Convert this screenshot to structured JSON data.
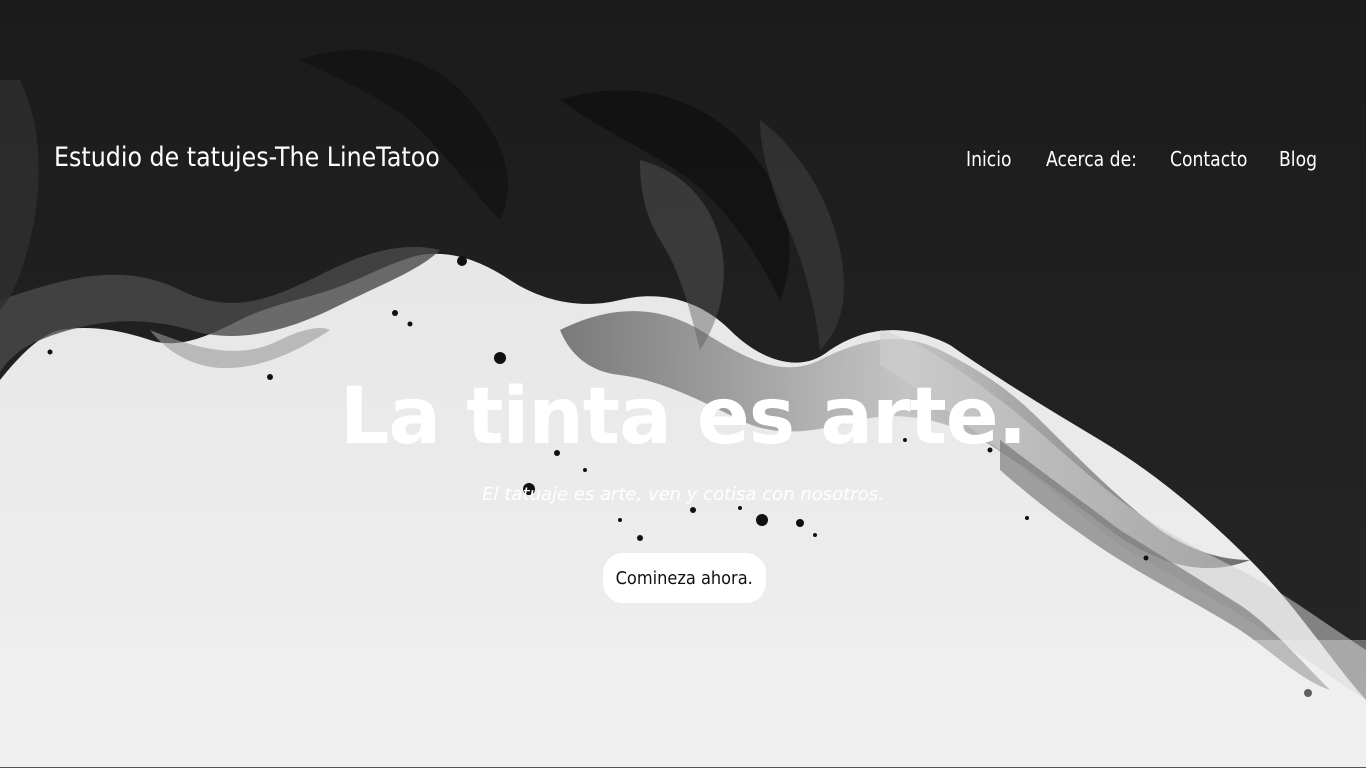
{
  "header": {
    "site_title": "Estudio de tatujes-The LineTatoo",
    "nav": [
      {
        "label": "Inicio"
      },
      {
        "label": "Acerca de:"
      },
      {
        "label": "Contacto"
      },
      {
        "label": "Blog"
      }
    ]
  },
  "hero": {
    "headline": "La tinta es arte.",
    "subheadline": "El tatuaje es arte, ven y cotisa con nosotros.",
    "cta_label": "Comineza ahora.",
    "background": "black-and-white-ink-splash"
  },
  "colors": {
    "dark_ink": "#1a1a1a",
    "light_background": "#ebebeb",
    "text": "#ffffff",
    "button_bg": "#ffffff",
    "button_text": "#111111"
  }
}
